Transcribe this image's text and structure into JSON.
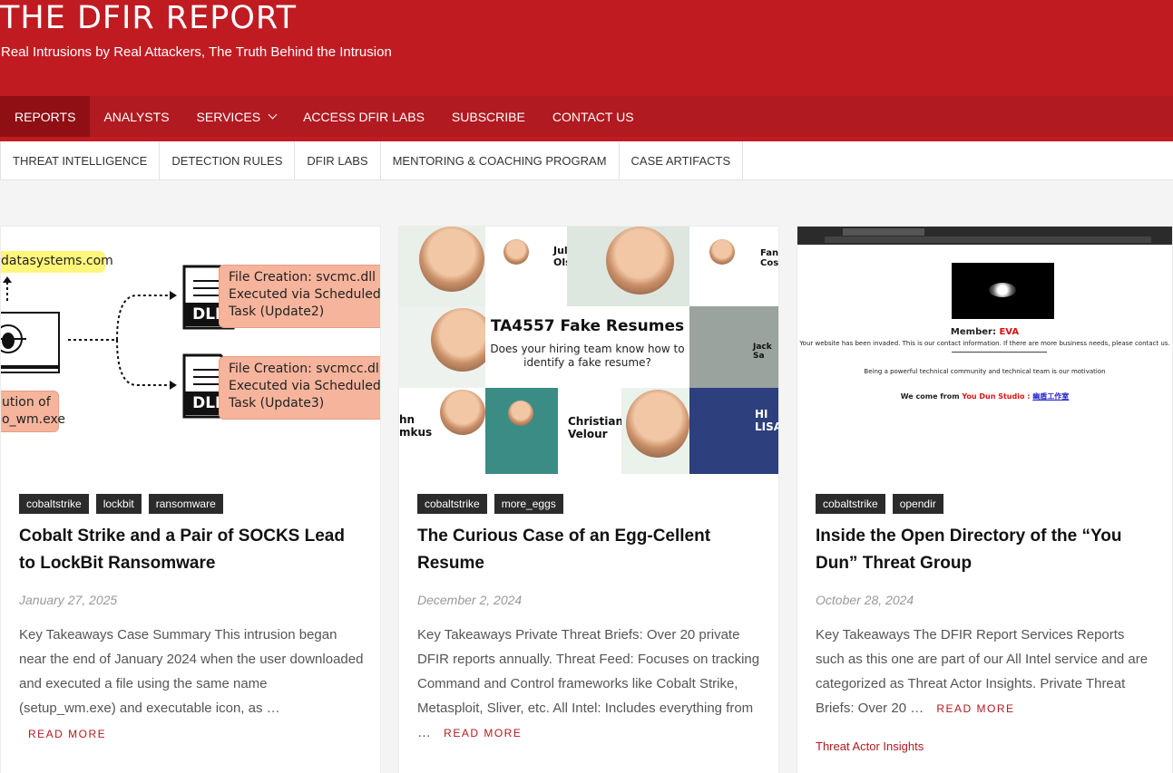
{
  "site": {
    "title": "THE DFIR REPORT",
    "description": "Real Intrusions by Real Attackers, The Truth Behind the Intrusion"
  },
  "main_nav": {
    "items": [
      "REPORTS",
      "ANALYSTS",
      "SERVICES",
      "ACCESS DFIR LABS",
      "SUBSCRIBE",
      "CONTACT US"
    ],
    "active": "REPORTS"
  },
  "secondary_nav": {
    "items": [
      "THREAT INTELLIGENCE",
      "DETECTION RULES",
      "DFIR LABS",
      "MENTORING & COACHING PROGRAM",
      "CASE ARTIFACTS"
    ]
  },
  "colors": {
    "brand_red": "#c11b22",
    "nav_red": "#b11a20",
    "active_nav": "#8f0f14",
    "tag_bg": "#2b2b2b"
  },
  "posts": [
    {
      "tags": [
        "cobaltstrike",
        "lockbit",
        "ransomware"
      ],
      "title": "Cobalt Strike and a Pair of SOCKS Lead to LockBit Ransomware",
      "date": "January 27, 2025",
      "excerpt": "Key Takeaways Case Summary This intrusion began near the end of January 2024 when the user downloaded and executed a file using the same name (setup_wm.exe) and executable icon, as …",
      "read_more": "READ MORE",
      "image": {
        "domain_label": "datasystems.com",
        "box1": [
          "File Creation: svcmc.dll",
          "Executed via Scheduled",
          "Task (Update2)"
        ],
        "box2": [
          "File Creation: svcmcc.dll",
          "Executed via Scheduled",
          "Task (Update3)"
        ],
        "dll_label": "DLL",
        "exec_label": [
          "ution of",
          "o_wm.exe"
        ]
      }
    },
    {
      "tags": [
        "cobaltstrike",
        "more_eggs"
      ],
      "title": "The Curious Case of an Egg-Cellent Resume",
      "date": "December 2, 2024",
      "excerpt": "Key Takeaways Private Threat Briefs: Over 20 private DFIR reports annually. Threat Feed: Focuses on tracking Command and Control frameworks like Cobalt Strike, Metasploit, Sliver, etc. All Intel: Includes everything from …",
      "read_more": "READ MORE",
      "image": {
        "banner_title": "TA4557 Fake Resumes",
        "banner_sub": "Does your hiring team know how to identify a fake resume?",
        "names": [
          "Julien Olsson",
          "Christian Velour",
          "Fank Cossio",
          "Jack Sa",
          "hn mkus",
          "LISA"
        ]
      }
    },
    {
      "tags": [
        "cobaltstrike",
        "opendir"
      ],
      "title": "Inside the Open Directory of the “You Dun” Threat Group",
      "date": "October 28, 2024",
      "excerpt": "Key Takeaways The DFIR Report Services Reports such as this one are part of our All Intel service and are categorized as Threat Actor Insights. Private Threat Briefs: Over 20 …",
      "read_more": "READ MORE",
      "category": "Threat Actor Insights",
      "image": {
        "member_label": "Member:",
        "member_name": "EVA",
        "line1": "Your website has been invaded. This is our contact information. If there are more business needs, please contact us.",
        "line2": "Being a powerful technical community and technical team is our motivation",
        "line3_prefix": "We come from",
        "line3_studio": "You Dun Studio :",
        "line3_cn": "幽盾工作室"
      }
    }
  ]
}
